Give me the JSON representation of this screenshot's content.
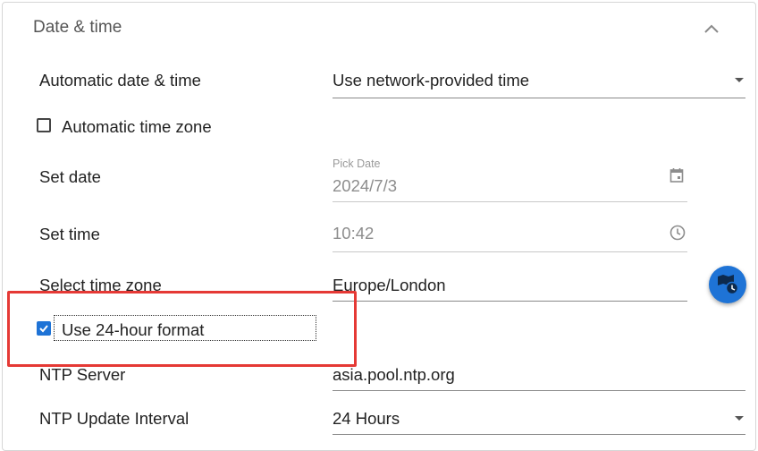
{
  "section": {
    "title": "Date & time",
    "collapse_icon": "chevron-up-icon"
  },
  "auto_datetime": {
    "label": "Automatic date & time",
    "value": "Use network-provided time"
  },
  "auto_timezone": {
    "label": "Automatic time zone",
    "checked": false
  },
  "set_date": {
    "label": "Set date",
    "helper": "Pick Date",
    "value": "2024/7/3",
    "icon": "calendar-icon"
  },
  "set_time": {
    "label": "Set time",
    "value": "10:42",
    "icon": "clock-icon"
  },
  "timezone": {
    "label": "Select time zone",
    "value": "Europe/London",
    "button_icon": "map-clock-icon"
  },
  "hour_format": {
    "label": "Use 24-hour format",
    "checked": true
  },
  "ntp_server": {
    "label": "NTP Server",
    "value": "asia.pool.ntp.org"
  },
  "ntp_interval": {
    "label": "NTP Update Interval",
    "value": "24 Hours"
  },
  "colors": {
    "accent": "#1e73d6",
    "highlight": "#e53935"
  }
}
